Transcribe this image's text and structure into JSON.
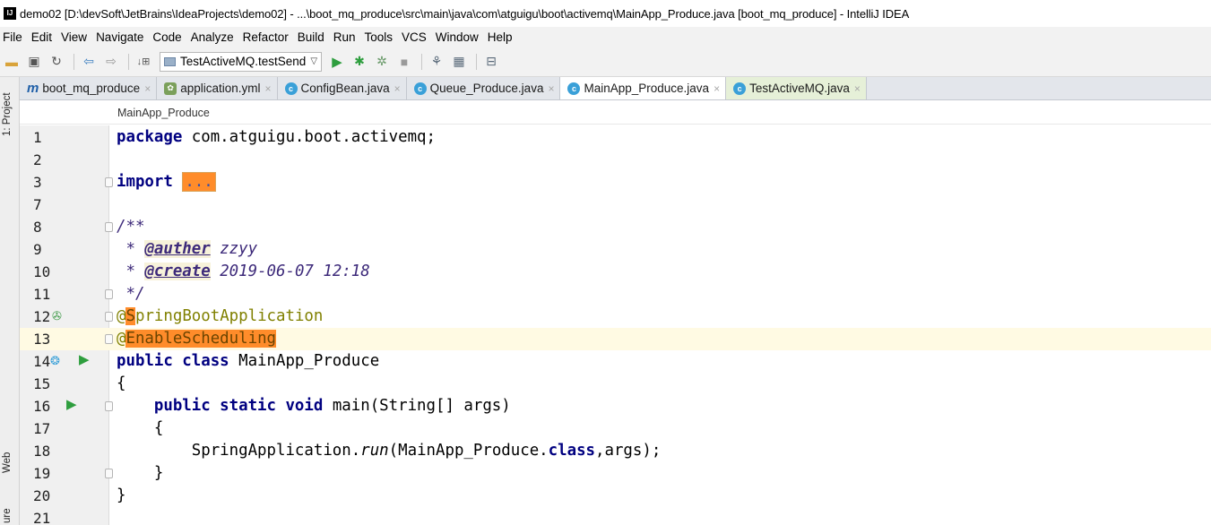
{
  "window": {
    "title": "demo02 [D:\\devSoft\\JetBrains\\IdeaProjects\\demo02] - ...\\boot_mq_produce\\src\\main\\java\\com\\atguigu\\boot\\activemq\\MainApp_Produce.java [boot_mq_produce] - IntelliJ IDEA",
    "app_icon": "IJ"
  },
  "menu": {
    "items": [
      "File",
      "Edit",
      "View",
      "Navigate",
      "Code",
      "Analyze",
      "Refactor",
      "Build",
      "Run",
      "Tools",
      "VCS",
      "Window",
      "Help"
    ]
  },
  "toolbar": {
    "run_config": "TestActiveMQ.testSend",
    "icons": [
      "open-folder-icon",
      "save-icon",
      "sync-icon",
      "back-icon",
      "forward-icon",
      "build-icon",
      "run-icon",
      "debug-icon",
      "coverage-icon",
      "stop-icon",
      "project-structure-icon",
      "sdk-icon",
      "vcs-icon"
    ]
  },
  "tabs": [
    {
      "label": "boot_mq_produce",
      "icon": "module-icon",
      "active": false
    },
    {
      "label": "application.yml",
      "icon": "yml-icon",
      "active": false
    },
    {
      "label": "ConfigBean.java",
      "icon": "class-icon",
      "active": false
    },
    {
      "label": "Queue_Produce.java",
      "icon": "class-icon",
      "active": false
    },
    {
      "label": "MainApp_Produce.java",
      "icon": "spring-class-icon",
      "active": true
    },
    {
      "label": "TestActiveMQ.java",
      "icon": "test-class-icon",
      "active": false
    }
  ],
  "side_tabs": {
    "project": "1: Project",
    "web": "Web",
    "structure": "ure"
  },
  "breadcrumb": "MainApp_Produce",
  "editor": {
    "line_numbers": [
      "1",
      "2",
      "3",
      "7",
      "8",
      "9",
      "10",
      "11",
      "12",
      "13",
      "14",
      "15",
      "16",
      "17",
      "18",
      "19",
      "20",
      "21"
    ],
    "package_kw": "package",
    "package_name": " com.atguigu.boot.activemq;",
    "import_kw": "import",
    "import_folded": "...",
    "doc_open": "/**",
    "doc_star": " * ",
    "author_tag": "@auther",
    "author_value": " zzyy",
    "create_tag": "@create",
    "create_value": " 2019-06-07 12:18",
    "doc_close": " */",
    "ann_spring_at": "@",
    "ann_spring_cursor": "S",
    "ann_spring_rest": "pringBootApplication",
    "ann_sched_at": "@",
    "ann_sched_name": "EnableScheduling",
    "kw_public_class": "public class",
    "class_name": " MainApp_Produce",
    "brace_open": "{",
    "kw_psv": "    public static void",
    "main_sig": " main(String[] args)",
    "brace_open_inner": "    {",
    "call_prefix": "        SpringApplication.",
    "call_method": "run",
    "call_mid": "(MainApp_Produce.",
    "call_kw_class": "class",
    "call_suffix": ",args);",
    "brace_close_inner": "    }",
    "brace_close": "}",
    "caret_line": "13",
    "colors": {
      "keyword": "#000080",
      "annotation": "#808000",
      "doc_comment": "#3d2a7a",
      "highlight": "#ff8c2a",
      "caret_row": "#fffae3"
    }
  }
}
